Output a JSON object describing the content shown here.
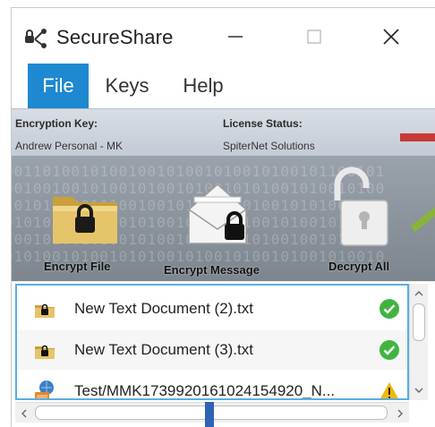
{
  "window": {
    "title": "SecureShare",
    "app_icon": "share-icon",
    "controls": {
      "minimize": "minimize-icon",
      "maximize": "maximize-icon",
      "close": "close-icon"
    }
  },
  "menu": {
    "items": [
      {
        "label": "File",
        "active": true
      },
      {
        "label": "Keys"
      },
      {
        "label": "Help"
      }
    ],
    "active_color": "#1e88d1"
  },
  "info": {
    "encryption_key_label": "Encryption Key:",
    "encryption_key_value": "Andrew Personal - MK",
    "license_status_label": "License Status:",
    "license_status_value": "SpiterNet Solutions"
  },
  "toolbar": {
    "buttons": [
      {
        "label": "Encrypt File",
        "icon": "folder-lock-icon"
      },
      {
        "label": "Encrypt Message",
        "icon": "envelope-lock-icon"
      },
      {
        "label": "Decrypt All",
        "icon": "unlock-icon"
      }
    ]
  },
  "files": [
    {
      "name": "New Text Document (2).txt",
      "icon": "locked-file-icon",
      "status": "success",
      "status_icon": "check-circle-icon"
    },
    {
      "name": "New Text Document (3).txt",
      "icon": "locked-file-icon",
      "status": "success",
      "status_icon": "check-circle-icon"
    },
    {
      "name": "Test/MMK1739920161024154920_N...",
      "icon": "ftp-file-icon",
      "status": "warning",
      "status_icon": "warning-icon"
    }
  ],
  "colors": {
    "success": "#3fb53f",
    "warning": "#f2b705",
    "list_border": "#5aaee6"
  }
}
